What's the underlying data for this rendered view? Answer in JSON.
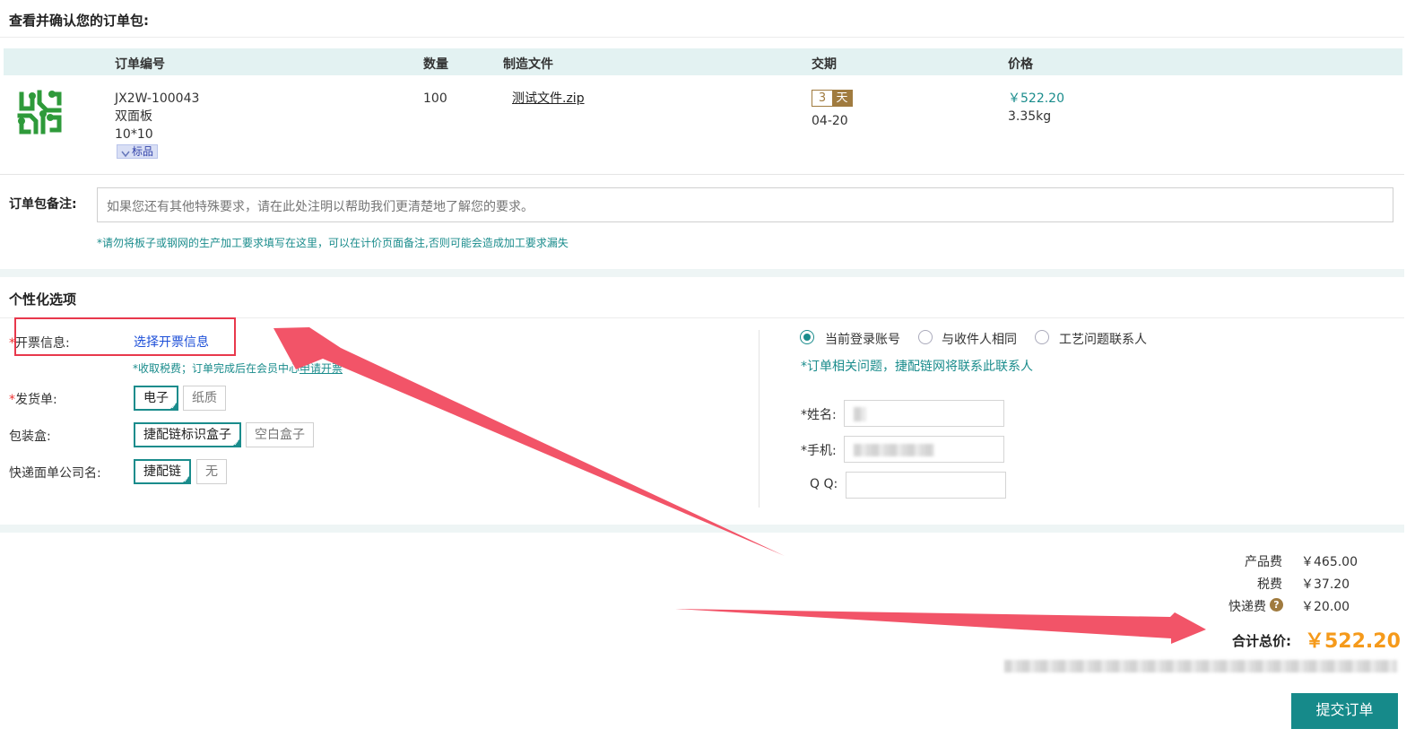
{
  "header": {
    "title": "查看并确认您的订单包:"
  },
  "table": {
    "columns": [
      "订单编号",
      "数量",
      "制造文件",
      "交期",
      "价格"
    ],
    "row": {
      "order_id": "JX2W-100043",
      "board_type": "双面板",
      "size": "10*10",
      "tag": "标品",
      "quantity": "100",
      "file": "测试文件.zip",
      "delivery_days": "3",
      "delivery_unit": "天",
      "delivery_date": "04-20",
      "price": "￥522.20",
      "weight": "3.35kg",
      "icon": "pcb-circuit-icon",
      "icon_color": "#2e9a3a"
    }
  },
  "remark": {
    "label": "订单包备注:",
    "placeholder": "如果您还有其他特殊要求，请在此处注明以帮助我们更清楚地了解您的要求。",
    "note": "*请勿将板子或钢网的生产加工要求填写在这里，可以在计价页面备注,否则可能会造成加工要求漏失"
  },
  "options": {
    "title": "个性化选项",
    "invoice": {
      "required_mark": "*",
      "label": "开票信息:",
      "link": "选择开票信息",
      "note_prefix": "*收取税费；订单完成后在会员中心",
      "note_link": "申请开票"
    },
    "delivery_note": {
      "required_mark": "*",
      "label": "发货单:",
      "choices": [
        "电子",
        "纸质"
      ],
      "selected": "电子"
    },
    "packaging": {
      "label": "包装盒:",
      "choices": [
        "捷配链标识盒子",
        "空白盒子"
      ],
      "selected": "捷配链标识盒子"
    },
    "express_label": {
      "label": "快递面单公司名:",
      "choices": [
        "捷配链",
        "无"
      ],
      "selected": "捷配链"
    },
    "contact": {
      "radios": [
        "当前登录账号",
        "与收件人相同",
        "工艺问题联系人"
      ],
      "selected": "当前登录账号",
      "note": "*订单相关问题，捷配链网将联系此联系人",
      "name_label": "*姓名:",
      "phone_label": "*手机:",
      "qq_label": "Q Q:"
    }
  },
  "totals": {
    "product_fee_label": "产品费",
    "product_fee": "￥465.00",
    "tax_label": "税费",
    "tax": "￥37.20",
    "shipping_label": "快递费",
    "shipping": "￥20.00",
    "help_icon": "?",
    "total_label": "合计总价:",
    "total": "￥522.20",
    "total_color": "#f59a1b"
  },
  "submit": {
    "label": "提交订单",
    "color": "#168a8a"
  },
  "annotation": {
    "highlight_color": "#e8384c",
    "arrow_color": "#f25468"
  }
}
